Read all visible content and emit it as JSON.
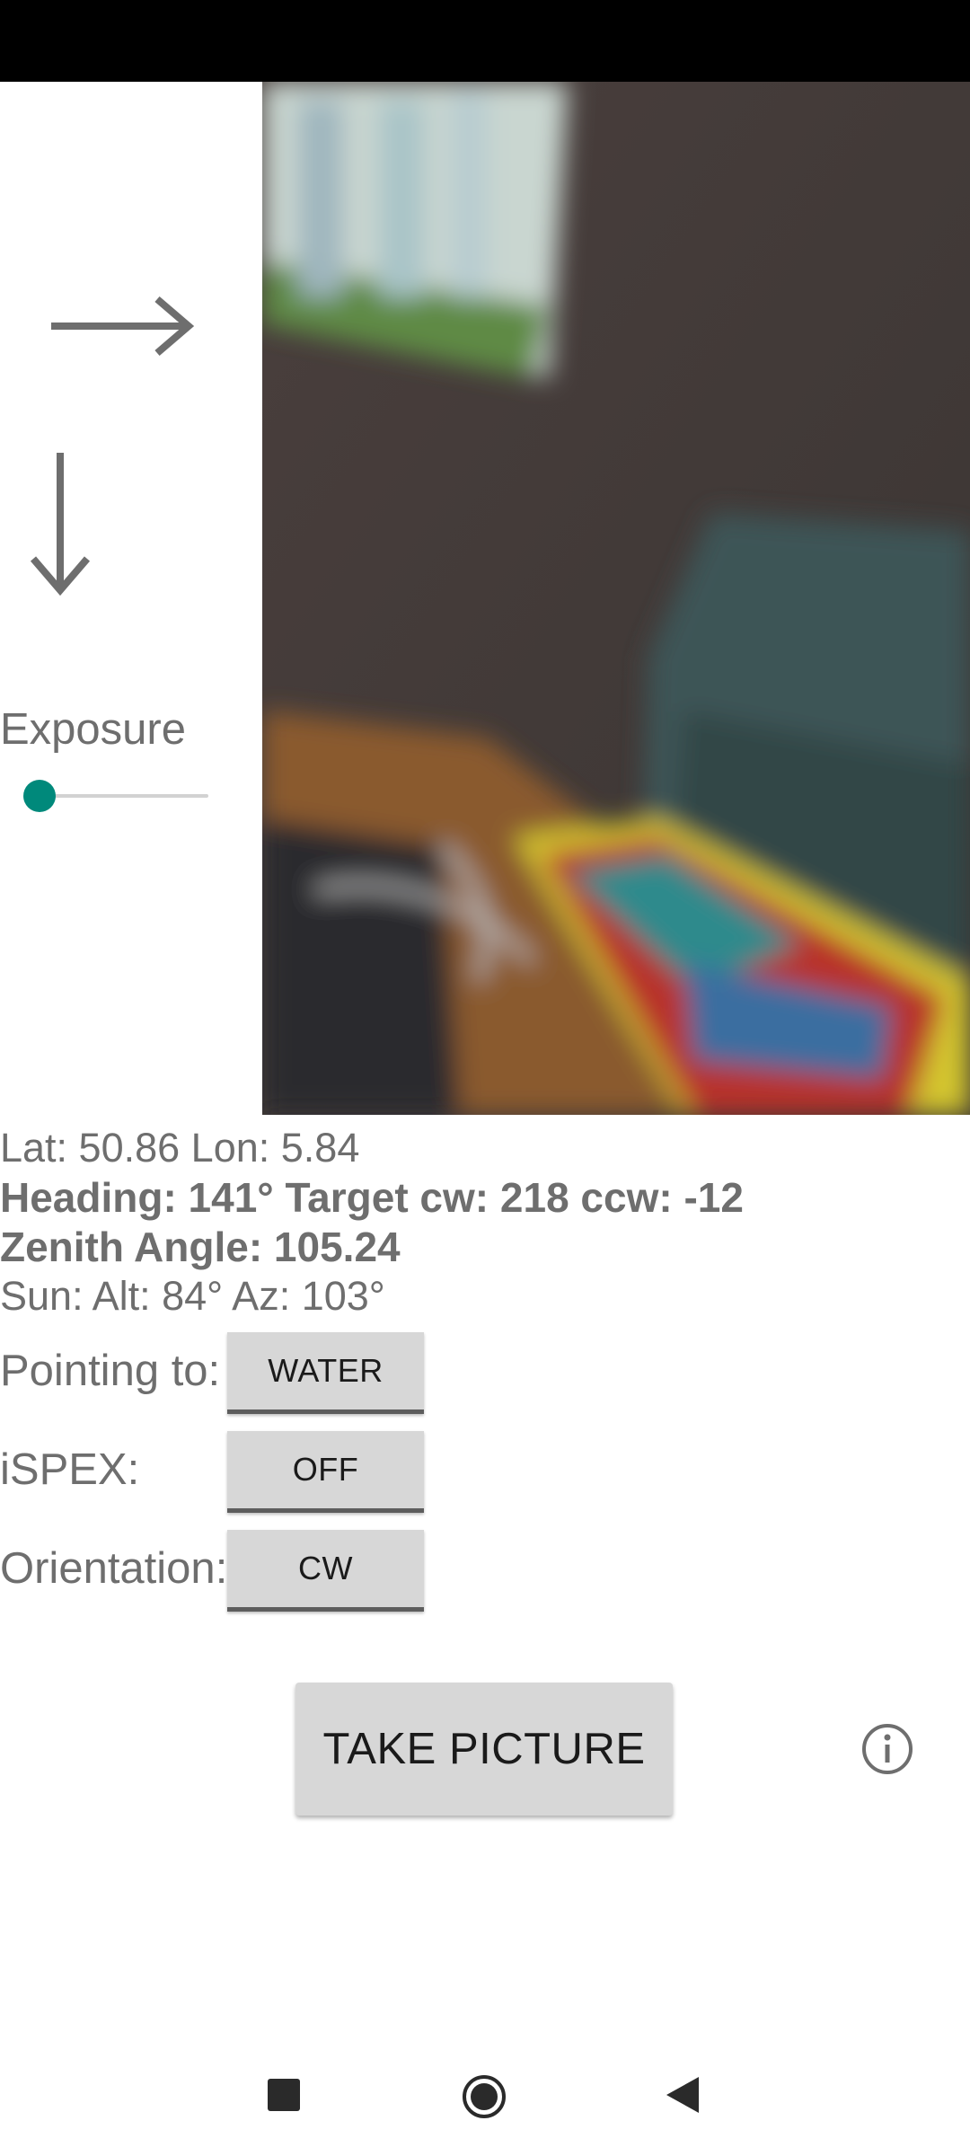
{
  "exposure": {
    "label": "Exposure",
    "value": 0.0
  },
  "readouts": {
    "location": "Lat: 50.86 Lon: 5.84",
    "heading": "Heading: 141° Target cw: 218 ccw: -12",
    "zenith": "Zenith Angle: 105.24",
    "sun": "Sun: Alt: 84° Az: 103°"
  },
  "controls": {
    "pointing_label": "Pointing to:",
    "pointing_value": "WATER",
    "ispex_label": "iSPEX:",
    "ispex_value": "OFF",
    "orientation_label": "Orientation:",
    "orientation_value": "CW"
  },
  "take_picture_label": "TAKE PICTURE",
  "icons": {
    "right": "arrow-right-icon",
    "down": "arrow-down-icon",
    "info": "info-icon",
    "recents": "nav-recents-icon",
    "home": "nav-home-icon",
    "back": "nav-back-icon"
  },
  "colors": {
    "accent": "#00897b",
    "text": "#6e6e6e",
    "button": "#d7d7d7"
  }
}
